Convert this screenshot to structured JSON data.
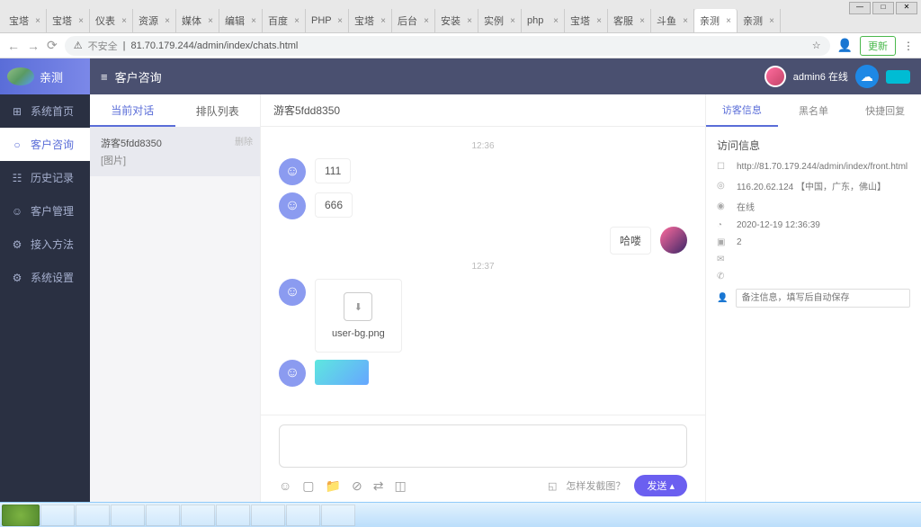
{
  "browser": {
    "tabs": [
      "宝塔",
      "宝塔",
      "仪表",
      "资源",
      "媒体",
      "编辑",
      "百度",
      "PHP",
      "宝塔",
      "后台",
      "安装",
      "实例",
      "php",
      "宝塔",
      "客服",
      "斗鱼",
      "亲测",
      "亲测"
    ],
    "active_tab": 16,
    "insecure_label": "不安全",
    "url": "81.70.179.244/admin/index/chats.html",
    "update_label": "更新"
  },
  "sidebar": {
    "logo_text": "亲测",
    "items": [
      {
        "icon": "⊞",
        "label": "系统首页"
      },
      {
        "icon": "○",
        "label": "客户咨询"
      },
      {
        "icon": "☷",
        "label": "历史记录"
      },
      {
        "icon": "☺",
        "label": "客户管理"
      },
      {
        "icon": "⚙",
        "label": "接入方法"
      },
      {
        "icon": "⚙",
        "label": "系统设置"
      }
    ],
    "active_index": 1
  },
  "topbar": {
    "icon": "≡",
    "title": "客户咨询",
    "user": "admin6 在线"
  },
  "conv": {
    "tabs": [
      "当前对话",
      "排队列表"
    ],
    "active_tab": 0,
    "items": [
      {
        "name": "游客5fdd8350",
        "sub": "[图片]",
        "del": "删除"
      }
    ]
  },
  "chat": {
    "title": "游客5fdd8350",
    "time1": "12:36",
    "time2": "12:37",
    "msg1": "111",
    "msg2": "666",
    "msg3": "哈喽",
    "file_name": "user-bg.png",
    "tip_label": "怎样发截图？",
    "send_label": "发送"
  },
  "panel": {
    "tabs": [
      "访客信息",
      "黑名单",
      "快捷回复"
    ],
    "active_tab": 0,
    "title": "访问信息",
    "url": "http://81.70.179.244/admin/index/front.html",
    "ip": "116.20.62.124 【中国，广东，佛山】",
    "status": "在线",
    "time": "2020-12-19 12:36:39",
    "device": "2",
    "remark_placeholder": "备注信息，填写后自动保存"
  }
}
